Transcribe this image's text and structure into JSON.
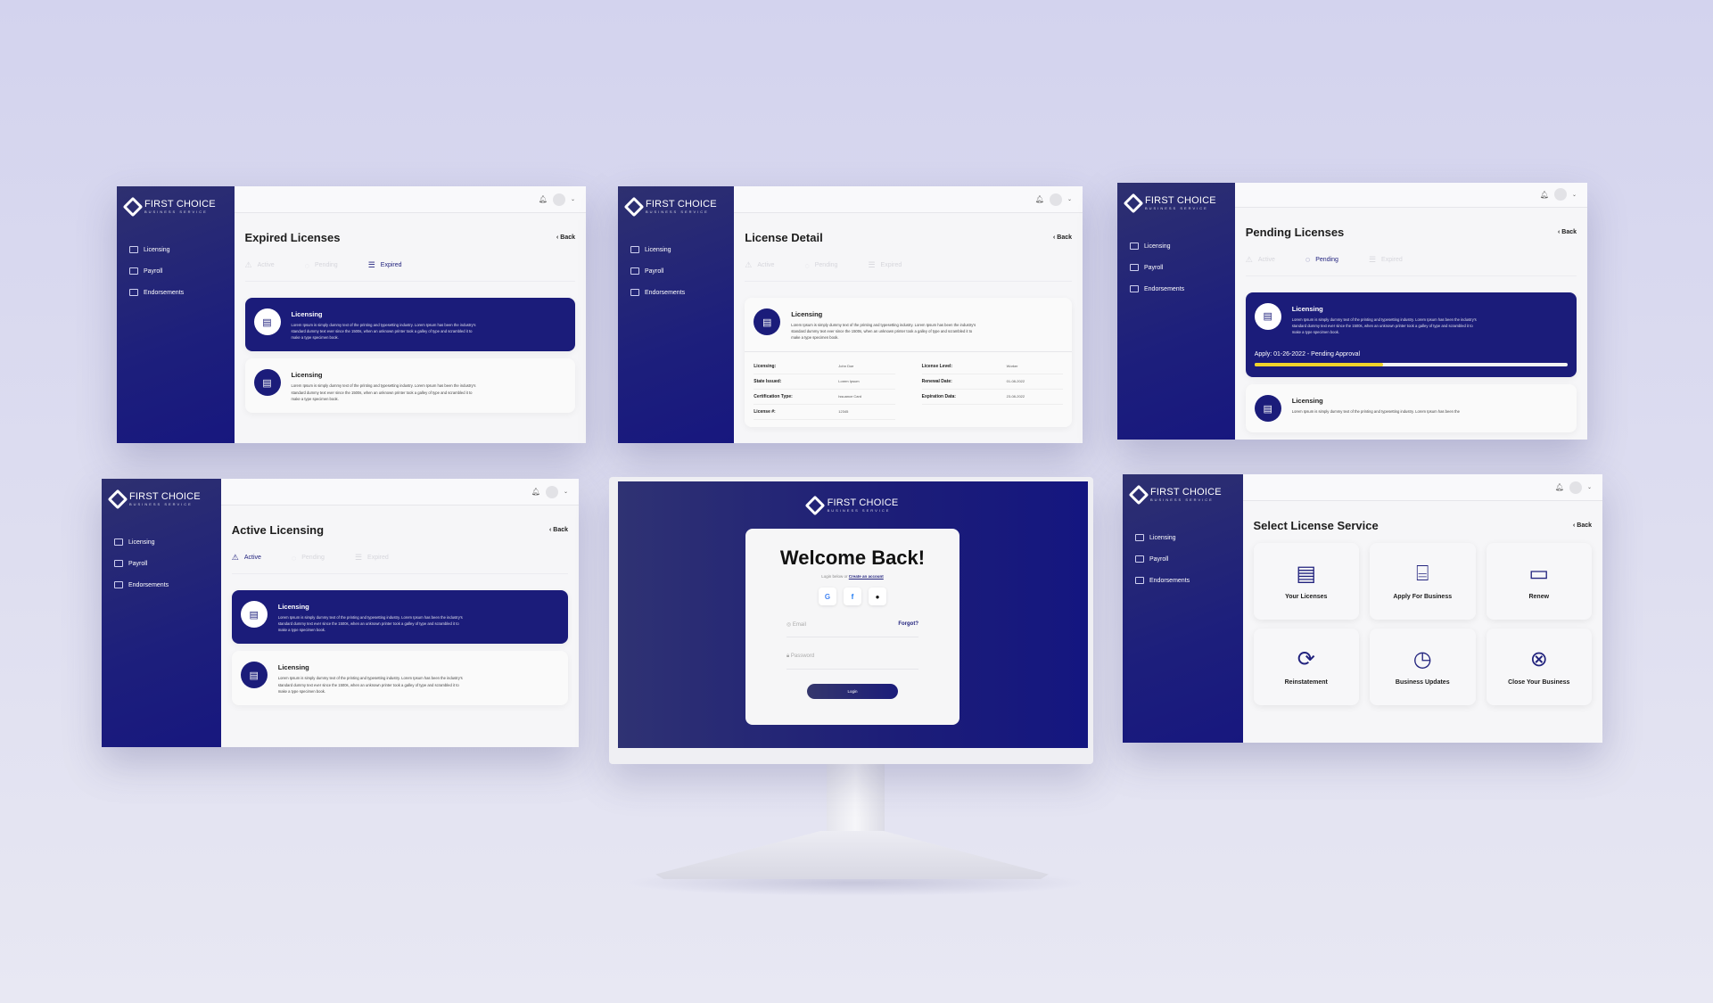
{
  "brand": {
    "name": "FIRST CHOICE",
    "tagline": "BUSINESS SERVICE"
  },
  "colors": {
    "primary": "#1b1c7a",
    "progress": "#f0d42a",
    "background": "#d3d3ee"
  },
  "sidebar_items": [
    {
      "label": "Licensing",
      "icon": "license-icon"
    },
    {
      "label": "Payroll",
      "icon": "payroll-icon"
    },
    {
      "label": "Endorsements",
      "icon": "endorsement-icon"
    }
  ],
  "tabs": [
    {
      "label": "Active",
      "icon": "warning-triangle-icon"
    },
    {
      "label": "Pending",
      "icon": "spinner-icon"
    },
    {
      "label": "Expired",
      "icon": "list-icon"
    }
  ],
  "back_label": "Back",
  "screens": {
    "expired": {
      "title": "Expired Licenses",
      "active_tab": 2,
      "cards": [
        {
          "title": "Licensing",
          "text": "Lorem Ipsum is simply dummy text of the printing and typesetting industry. Lorem Ipsum has been the industry's standard dummy text ever since the 1500s, when an unknown printer took a galley of type and scrambled it to make a type specimen book.",
          "highlighted": true
        },
        {
          "title": "Licensing",
          "text": "Lorem Ipsum is simply dummy text of the printing and typesetting industry. Lorem Ipsum has been the industry's standard dummy text ever since the 1500s, when an unknown printer took a galley of type and scrambled it to make a type specimen book.",
          "highlighted": false
        }
      ]
    },
    "detail": {
      "title": "License Detail",
      "active_tab": -1,
      "card": {
        "title": "Licensing",
        "text": "Lorem Ipsum is simply dummy text of the printing and typesetting industry. Lorem Ipsum has been the industry's standard dummy text ever since the 1500s, when an unknown printer took a galley of type and scrambled it to make a type specimen book."
      },
      "fields_left": [
        {
          "label": "Licensing:",
          "value": "John Doe"
        },
        {
          "label": "State Issued:",
          "value": "Lorem Ipsum"
        },
        {
          "label": "Certification Type:",
          "value": "Issuance Card"
        },
        {
          "label": "License #:",
          "value": "12345"
        }
      ],
      "fields_right": [
        {
          "label": "License Level:",
          "value": "Worker"
        },
        {
          "label": "Renewal Date:",
          "value": "01-08-2022"
        },
        {
          "label": "Expiration Data:",
          "value": "23-08-2022"
        }
      ]
    },
    "pending": {
      "title": "Pending Licenses",
      "active_tab": 1,
      "cards": [
        {
          "title": "Licensing",
          "text": "Lorem Ipsum is simply dummy text of the printing and typesetting industry. Lorem Ipsum has been the industry's standard dummy text ever since the 1500s, when an unknown printer took a galley of type and scrambled it to make a type specimen book.",
          "highlighted": true,
          "status": "Apply: 01-26-2022 - Pending Approval",
          "progress": 0.41
        },
        {
          "title": "Licensing",
          "text": "Lorem Ipsum is simply dummy text of the printing and typesetting industry. Lorem Ipsum has been the",
          "highlighted": false
        }
      ]
    },
    "active": {
      "title": "Active Licensing",
      "active_tab": 0,
      "cards": [
        {
          "title": "Licensing",
          "text": "Lorem Ipsum is simply dummy text of the printing and typesetting industry. Lorem Ipsum has been the industry's standard dummy text ever since the 1500s, when an unknown printer took a galley of type and scrambled it to make a type specimen book.",
          "highlighted": true
        },
        {
          "title": "Licensing",
          "text": "Lorem Ipsum is simply dummy text of the printing and typesetting industry. Lorem Ipsum has been the industry's standard dummy text ever since the 1500s, when an unknown printer took a galley of type and scrambled it to make a type specimen book.",
          "highlighted": false
        }
      ]
    },
    "select": {
      "title": "Select License Service",
      "tiles": [
        {
          "label": "Your Licenses",
          "icon": "certificate-icon"
        },
        {
          "label": "Apply For Business",
          "icon": "briefcase-icon"
        },
        {
          "label": "Renew",
          "icon": "diploma-icon"
        },
        {
          "label": "Reinstatement",
          "icon": "refresh-icon"
        },
        {
          "label": "Business Updates",
          "icon": "clock-update-icon"
        },
        {
          "label": "Close Your Business",
          "icon": "close-circle-icon"
        }
      ]
    }
  },
  "login": {
    "title": "Welcome Back!",
    "subtitle": "Login below or",
    "create_link": "Create an account",
    "socials": [
      {
        "label": "G",
        "icon": "google-icon",
        "color": "#4285f4"
      },
      {
        "label": "f",
        "icon": "facebook-icon",
        "color": "#1877f2"
      },
      {
        "label": "",
        "icon": "apple-icon",
        "color": "#111111"
      }
    ],
    "email_placeholder": "Email",
    "forgot": "Forgot?",
    "password_placeholder": "Password",
    "login_button": "Login"
  }
}
